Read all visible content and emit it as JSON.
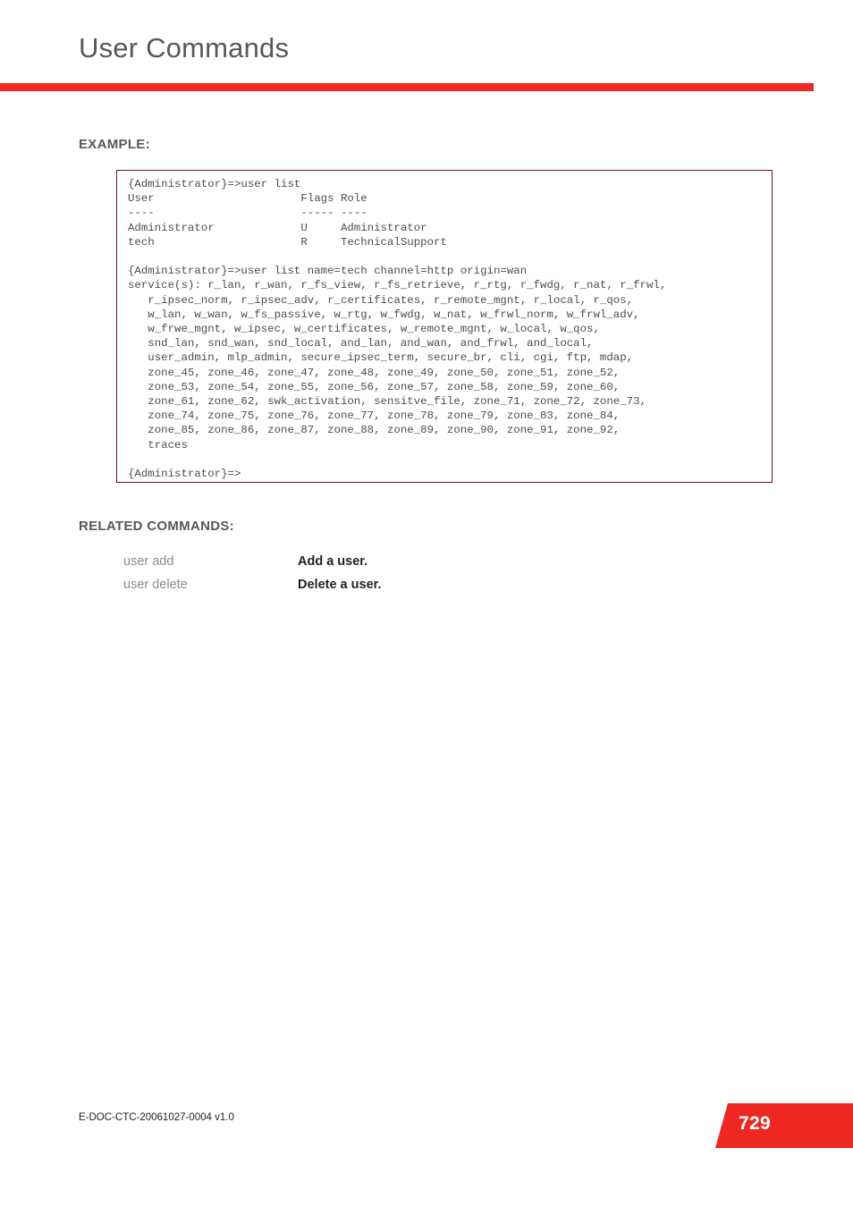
{
  "header": {
    "title": "User Commands",
    "rule_color": "#ee2722"
  },
  "sections": {
    "example_heading": "EXAMPLE:",
    "related_heading": "RELATED COMMANDS:"
  },
  "example": {
    "border_color": "#6d1515",
    "code": "{Administrator}=>user list\nUser                      Flags Role\n----                      ----- ----\nAdministrator             U     Administrator\ntech                      R     TechnicalSupport\n\n{Administrator}=>user list name=tech channel=http origin=wan\nservice(s): r_lan, r_wan, r_fs_view, r_fs_retrieve, r_rtg, r_fwdg, r_nat, r_frwl,\n   r_ipsec_norm, r_ipsec_adv, r_certificates, r_remote_mgnt, r_local, r_qos,\n   w_lan, w_wan, w_fs_passive, w_rtg, w_fwdg, w_nat, w_frwl_norm, w_frwl_adv,\n   w_frwe_mgnt, w_ipsec, w_certificates, w_remote_mgnt, w_local, w_qos,\n   snd_lan, snd_wan, snd_local, and_lan, and_wan, and_frwl, and_local,\n   user_admin, mlp_admin, secure_ipsec_term, secure_br, cli, cgi, ftp, mdap,\n   zone_45, zone_46, zone_47, zone_48, zone_49, zone_50, zone_51, zone_52,\n   zone_53, zone_54, zone_55, zone_56, zone_57, zone_58, zone_59, zone_60,\n   zone_61, zone_62, swk_activation, sensitve_file, zone_71, zone_72, zone_73,\n   zone_74, zone_75, zone_76, zone_77, zone_78, zone_79, zone_83, zone_84,\n   zone_85, zone_86, zone_87, zone_88, zone_89, zone_90, zone_91, zone_92,\n   traces\n\n{Administrator}=>"
  },
  "related_commands": [
    {
      "command": "user add",
      "description": "Add a user."
    },
    {
      "command": "user delete",
      "description": "Delete a user."
    }
  ],
  "footer": {
    "doc_id": "E-DOC-CTC-20061027-0004 v1.0",
    "page_number": "729",
    "badge_color": "#ee2722"
  }
}
